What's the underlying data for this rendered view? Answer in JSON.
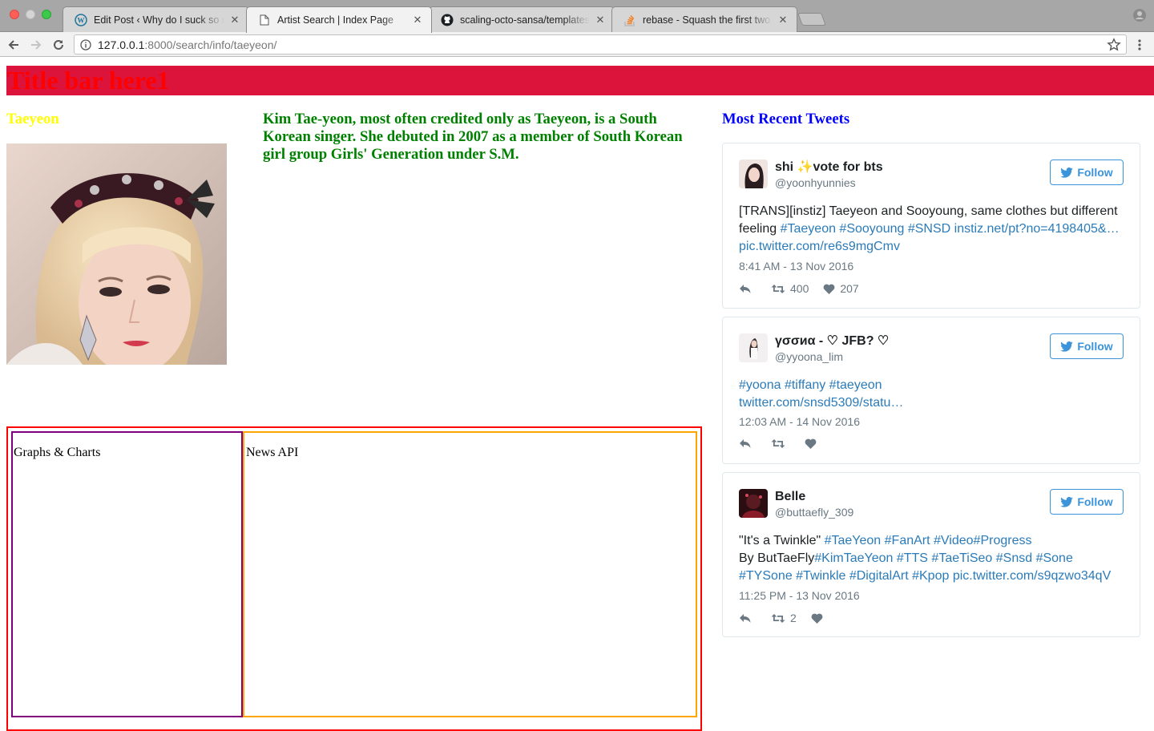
{
  "browser": {
    "tabs": [
      {
        "title": "Edit Post ‹ Why do I suck so much",
        "icon": "wordpress-icon",
        "active": false
      },
      {
        "title": "Artist Search | Index Page",
        "icon": "document-icon",
        "active": true
      },
      {
        "title": "scaling-octo-sansa/templates/",
        "icon": "github-icon",
        "active": false
      },
      {
        "title": "rebase - Squash the first two c",
        "icon": "stackoverflow-icon",
        "active": false
      }
    ],
    "close_glyph": "✕",
    "url_host": "127.0.0.1",
    "url_path": ":8000/search/info/taeyeon/"
  },
  "page": {
    "title_bar": "Title bar here1",
    "artist_name": "Taeyeon",
    "bio": "Kim Tae-yeon, most often credited only as Taeyeon, is a South Korean singer. She debuted in 2007 as a member of South Korean girl group Girls' Generation under S.M.",
    "tweets_heading": "Most Recent Tweets",
    "graphs_label": "Graphs & Charts",
    "news_label": "News API"
  },
  "tweets": [
    {
      "name": "shi ✨vote for bts",
      "handle": "@yoonhyunnies",
      "follow": "Follow",
      "line1": "[TRANS][instiz] Taeyeon and Sooyoung, same clothes but different",
      "line2_text": "feeling ",
      "line2_link": "#Taeyeon #Sooyoung #SNSD instiz.net/pt?no=4198405&…",
      "line3_link": "pic.twitter.com/re6s9mgCmv",
      "date": "8:41 AM - 13 Nov 2016",
      "retweets": "400",
      "likes": "207"
    },
    {
      "name": "γσσиα - ♡ JFB? ♡",
      "handle": "@yyoona_lim",
      "follow": "Follow",
      "line1_link": "#yoona #tiffany #taeyeon",
      "line2_link": "twitter.com/snsd5309/statu…",
      "date": "12:03 AM - 14 Nov 2016",
      "retweets": "",
      "likes": ""
    },
    {
      "name": "Belle",
      "handle": "@buttaefly_309",
      "follow": "Follow",
      "line1_text": "\"It's a Twinkle\" ",
      "line1_link": "#TaeYeon #FanArt #Video#Progress",
      "line2_text": "By ButTaeFly",
      "line2_link": "#KimTaeYeon #TTS #TaeTiSeo #Snsd #Sone",
      "line3_link": "#TYSone #Twinkle #DigitalArt #Kpop pic.twitter.com/s9qzwo34qV",
      "date": "11:25 PM - 13 Nov 2016",
      "retweets": "2",
      "likes": ""
    }
  ],
  "colors": {
    "title_bar_bg": "#dc143c",
    "title_text": "#ff0000",
    "artist_name": "#ffff00",
    "bio": "#008000",
    "tweets_heading": "#0000ff",
    "twitter_link": "#2b7bb9",
    "twitter_blue": "#3b94d9"
  }
}
